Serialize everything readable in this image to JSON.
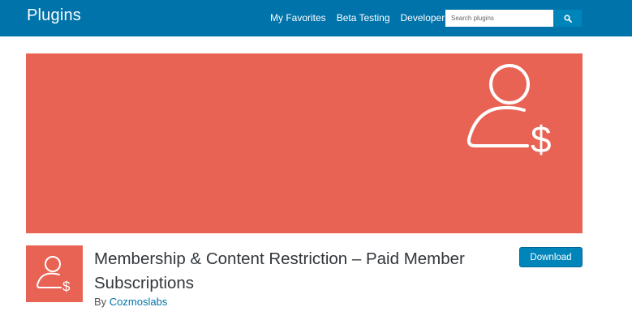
{
  "header": {
    "site_title": "Plugins",
    "nav": [
      "My Favorites",
      "Beta Testing",
      "Developers"
    ],
    "search_placeholder": "Search plugins",
    "search_icon": "search-icon"
  },
  "colors": {
    "header_bg": "#0073aa",
    "banner_bg": "#e96354",
    "link": "#0073aa",
    "button_bg": "#0085ba"
  },
  "banner": {
    "icon": "user-dollar-icon"
  },
  "plugin": {
    "icon": "user-dollar-icon",
    "title": "Membership & Content Restriction – Paid Member Subscriptions",
    "by": "By",
    "author": "Cozmoslabs",
    "download_label": "Download"
  }
}
